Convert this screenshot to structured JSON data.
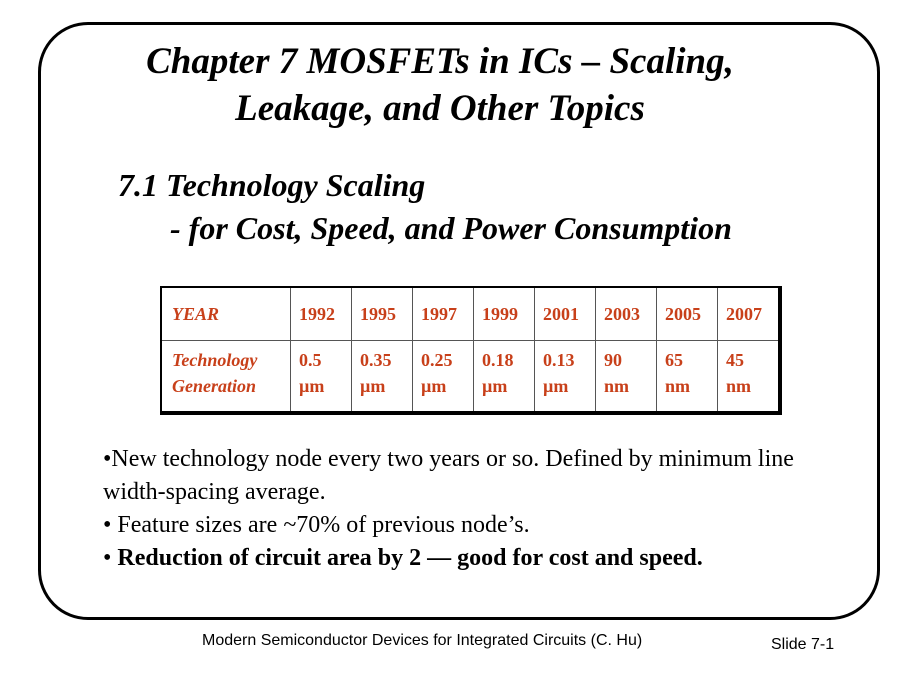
{
  "title": {
    "line1": "Chapter 7  MOSFETs in ICs – Scaling,",
    "line2": "Leakage, and Other Topics"
  },
  "section": {
    "heading": "7.1 Technology Scaling",
    "subheading": "- for Cost, Speed, and Power Consumption"
  },
  "table": {
    "row_headers": [
      "YEAR",
      "Technology",
      "Generation"
    ],
    "years": [
      "1992",
      "1995",
      "1997",
      "1999",
      "2001",
      "2003",
      "2005",
      "2007"
    ],
    "generations": [
      [
        "0.5",
        "µm"
      ],
      [
        "0.35",
        "µm"
      ],
      [
        "0.25",
        "µm"
      ],
      [
        "0.18",
        "µm"
      ],
      [
        "0.13",
        "µm"
      ],
      [
        "90",
        "nm"
      ],
      [
        "65",
        "nm"
      ],
      [
        "45",
        "nm"
      ]
    ],
    "text_color": "#c8401a"
  },
  "bullets": [
    "•New technology node every two years or so. Defined by minimum line width-spacing average.",
    "• Feature sizes are ~70% of  previous node’s.",
    {
      "prefix": "• ",
      "bold": "Reduction of circuit area by 2 — good for cost and speed."
    }
  ],
  "footer": {
    "source": "Modern Semiconductor Devices for Integrated Circuits (C. Hu)",
    "slide": "Slide 7-1"
  }
}
